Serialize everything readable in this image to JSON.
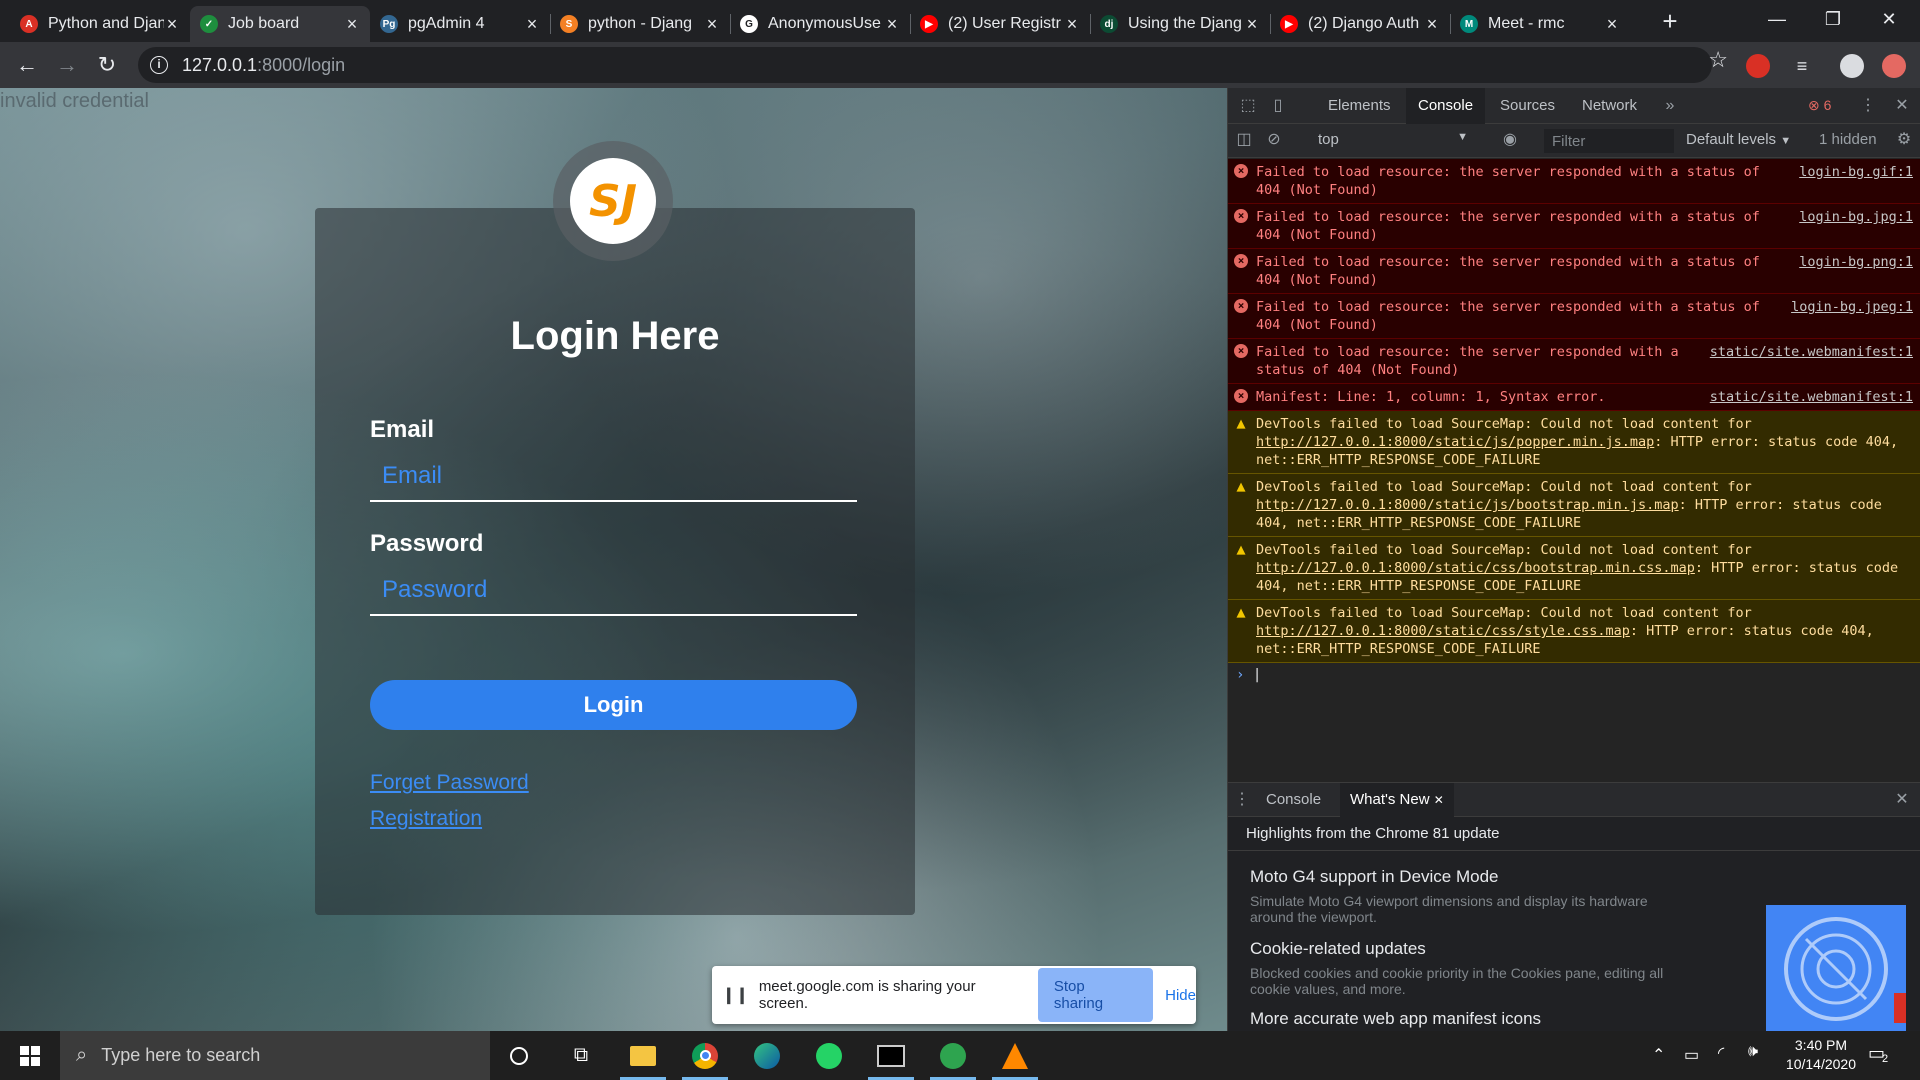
{
  "browser": {
    "tabs": [
      {
        "title": "Python and Djang",
        "fav_color": "#d93025",
        "fav_glyph": "A"
      },
      {
        "title": "Job board",
        "fav_color": "#1e8e3e",
        "fav_glyph": "✓",
        "active": true
      },
      {
        "title": "pgAdmin 4",
        "fav_color": "#336791",
        "fav_glyph": "Pg"
      },
      {
        "title": "python - Djang",
        "fav_color": "#f48024",
        "fav_glyph": "S"
      },
      {
        "title": "AnonymousUse",
        "fav_color": "#ffffff",
        "fav_glyph": "G"
      },
      {
        "title": "(2) User Registr",
        "fav_color": "#ff0000",
        "fav_glyph": "▶"
      },
      {
        "title": "Using the Djang",
        "fav_color": "#0c4b33",
        "fav_glyph": "dj"
      },
      {
        "title": "(2) Django Auth",
        "fav_color": "#ff0000",
        "fav_glyph": "▶"
      },
      {
        "title": "Meet - rmc",
        "fav_color": "#00897b",
        "fav_glyph": "M"
      }
    ],
    "url_host": "127.0.0.1",
    "url_path": ":8000/login"
  },
  "page": {
    "error_text": "invalid credential",
    "logo_text": "SJ",
    "title": "Login Here",
    "email_label": "Email",
    "email_placeholder": "Email",
    "password_label": "Password",
    "password_placeholder": "Password",
    "login_button": "Login",
    "forget_link": "Forget Password",
    "registration_link": "Registration"
  },
  "share_banner": {
    "text": "meet.google.com is sharing your screen.",
    "stop_button": "Stop sharing",
    "hide_button": "Hide"
  },
  "devtools": {
    "tabs": [
      "Elements",
      "Console",
      "Sources",
      "Network"
    ],
    "active_tab": "Console",
    "error_count": "6",
    "context": "top",
    "filter_placeholder": "Filter",
    "levels": "Default levels",
    "hidden": "1 hidden",
    "messages": [
      {
        "level": "error",
        "text": "Failed to load resource: the server responded with a status of 404 (Not Found)",
        "source": "login-bg.gif:1"
      },
      {
        "level": "error",
        "text": "Failed to load resource: the server responded with a status of 404 (Not Found)",
        "source": "login-bg.jpg:1"
      },
      {
        "level": "error",
        "text": "Failed to load resource: the server responded with a status of 404 (Not Found)",
        "source": "login-bg.png:1"
      },
      {
        "level": "error",
        "text": "Failed to load resource: the server responded with a status of 404 (Not Found)",
        "source": "login-bg.jpeg:1"
      },
      {
        "level": "error",
        "text": "Failed to load resource: the server responded with a status of 404 (Not Found)",
        "source": "static/site.webmanifest:1"
      },
      {
        "level": "error",
        "text": "Manifest: Line: 1, column: 1, Syntax error.",
        "source": "static/site.webmanifest:1"
      },
      {
        "level": "warning",
        "pre": "DevTools failed to load SourceMap: Could not load content for ",
        "url": "http://127.0.0.1:8000/static/js/popper.min.js.map",
        "post": ": HTTP error: status code 404, net::ERR_HTTP_RESPONSE_CODE_FAILURE"
      },
      {
        "level": "warning",
        "pre": "DevTools failed to load SourceMap: Could not load content for ",
        "url": "http://127.0.0.1:8000/static/js/bootstrap.min.js.map",
        "post": ": HTTP error: status code 404, net::ERR_HTTP_RESPONSE_CODE_FAILURE"
      },
      {
        "level": "warning",
        "pre": "DevTools failed to load SourceMap: Could not load content for ",
        "url": "http://127.0.0.1:8000/static/css/bootstrap.min.css.map",
        "post": ": HTTP error: status code 404, net::ERR_HTTP_RESPONSE_CODE_FAILURE"
      },
      {
        "level": "warning",
        "pre": "DevTools failed to load SourceMap: Could not load content for ",
        "url": "http://127.0.0.1:8000/static/css/style.css.map",
        "post": ": HTTP error: status code 404, net::ERR_HTTP_RESPONSE_CODE_FAILURE"
      }
    ],
    "drawer": {
      "tabs": [
        "Console",
        "What's New"
      ],
      "active_tab": "What's New",
      "header": "Highlights from the Chrome 81 update",
      "items": [
        {
          "title": "Moto G4 support in Device Mode",
          "desc": "Simulate Moto G4 viewport dimensions and display its hardware around the viewport."
        },
        {
          "title": "Cookie-related updates",
          "desc": "Blocked cookies and cookie priority in the Cookies pane, editing all cookie values, and more."
        },
        {
          "title": "More accurate web app manifest icons",
          "desc": ""
        }
      ]
    }
  },
  "taskbar": {
    "search_placeholder": "Type here to search",
    "time": "3:40 PM",
    "date": "10/14/2020",
    "notification_count": "2"
  }
}
